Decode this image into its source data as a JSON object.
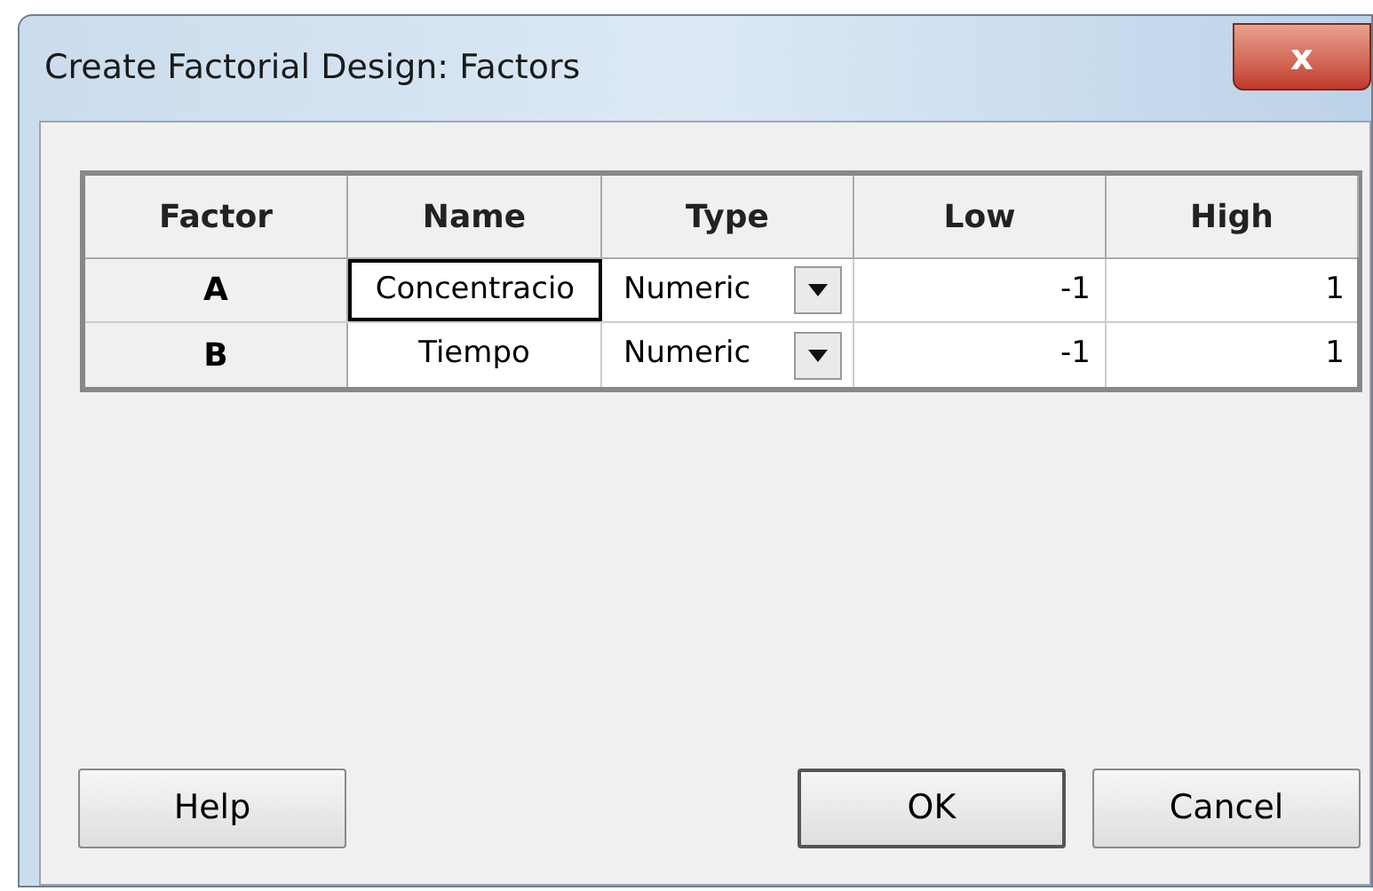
{
  "window": {
    "title": "Create Factorial Design: Factors",
    "close": "x"
  },
  "table": {
    "columns": [
      "Factor",
      "Name",
      "Type",
      "Low",
      "High"
    ],
    "rows": [
      {
        "factor": "A",
        "name": "Concentracio",
        "name_focused": true,
        "type": "Numeric",
        "low": "-1",
        "high": "1"
      },
      {
        "factor": "B",
        "name": "Tiempo",
        "name_focused": false,
        "type": "Numeric",
        "low": "-1",
        "high": "1"
      }
    ]
  },
  "buttons": [
    {
      "label": "Help",
      "default": false
    },
    {
      "label": "OK",
      "default": true
    },
    {
      "label": "Cancel",
      "default": false
    }
  ]
}
